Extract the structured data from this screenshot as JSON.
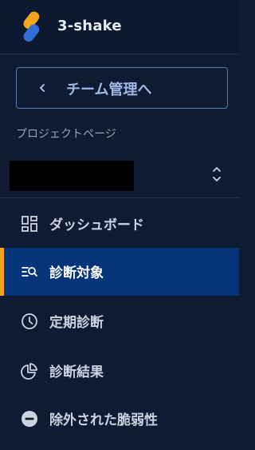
{
  "brand": {
    "name": "3-shake",
    "logo_icon": "3-shake-logo-icon"
  },
  "back_button": {
    "label": "チーム管理へ",
    "icon": "chevron-left-icon"
  },
  "project": {
    "section_label": "プロジェクトページ",
    "name_redacted": true,
    "selector_icon": "unfold-arrows-icon"
  },
  "nav": {
    "items": [
      {
        "label": "ダッシュボード",
        "icon": "dashboard-grid-icon",
        "active": false
      },
      {
        "label": "診断対象",
        "icon": "list-search-icon",
        "active": true
      },
      {
        "label": "定期診断",
        "icon": "clock-icon",
        "active": false
      },
      {
        "label": "診断結果",
        "icon": "pie-chart-icon",
        "active": false
      },
      {
        "label": "除外された脆弱性",
        "icon": "minus-circle-icon",
        "active": false
      }
    ]
  },
  "colors": {
    "sidebar_bg": "#0f1a33",
    "active_bg": "#04357a",
    "active_accent": "#f2a51d",
    "back_button_border": "#5979b3",
    "back_button_text": "#9fb8e6",
    "logo_orange": "#f2a51d",
    "logo_blue": "#2f6fd6"
  }
}
